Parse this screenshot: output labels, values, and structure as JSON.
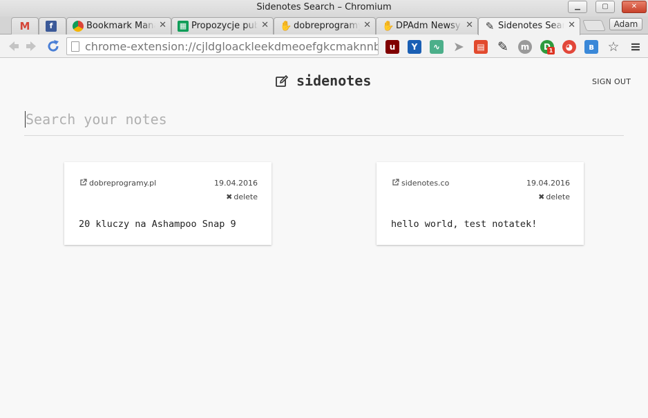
{
  "window": {
    "title": "Sidenotes Search – Chromium",
    "min_label": "▁",
    "max_label": "▢",
    "close_label": "✕"
  },
  "tabs": [
    {
      "label": "",
      "icon": "gmail-icon",
      "color": "#d44638"
    },
    {
      "label": "",
      "icon": "facebook-icon",
      "color": "#3b5998"
    },
    {
      "label": "Bookmark Mana",
      "icon": "bookmark-manager-icon",
      "color": "#e8a33b"
    },
    {
      "label": "Propozycje publ",
      "icon": "sheets-icon",
      "color": "#0f9d58"
    },
    {
      "label": "dobreprogramy",
      "icon": "dobreprogramy-icon",
      "color": "#e6b800"
    },
    {
      "label": "DPAdm Newsy",
      "icon": "dobreprogramy-icon",
      "color": "#e6b800"
    },
    {
      "label": "Sidenotes Searc",
      "icon": "edit-icon",
      "color": "#333333",
      "active": true
    }
  ],
  "tab_close": "✕",
  "profile_label": "Adam",
  "toolbar": {
    "url": "chrome-extension://cjldgloackleekdmeoefgkcmaknnbbpb/ht",
    "extensions": [
      {
        "name": "ublock-icon",
        "glyph": "u",
        "color": "#800000"
      },
      {
        "name": "y-extension-icon",
        "glyph": "Y",
        "color": "#1a5fb4"
      },
      {
        "name": "audio-wave-icon",
        "glyph": "∿",
        "color": "#4caf8a"
      },
      {
        "name": "cursor-icon",
        "glyph": "➤",
        "color": "#9a9a9a"
      },
      {
        "name": "color-stack-icon",
        "glyph": "▤",
        "color": "#e24a2e"
      },
      {
        "name": "sidenotes-edit-icon",
        "glyph": "✎",
        "color": "#333333"
      },
      {
        "name": "m-extension-icon",
        "glyph": "m",
        "color": "#9a9a9a"
      },
      {
        "name": "d-extension-icon",
        "glyph": "D",
        "color": "#2e9b3e"
      },
      {
        "name": "color-wheel-icon",
        "glyph": "◕",
        "color": "#e2473a"
      },
      {
        "name": "b-extension-icon",
        "glyph": "ʙ",
        "color": "#3a88d8"
      },
      {
        "name": "bookmark-star-icon",
        "glyph": "☆",
        "color": "#555555"
      },
      {
        "name": "menu-icon",
        "glyph": "≡",
        "color": "#444444"
      }
    ],
    "badge_count": "1"
  },
  "app": {
    "brand_name": "sidenotes",
    "sign_out": "SIGN OUT",
    "search_placeholder": "Search your notes",
    "search_value": ""
  },
  "notes": [
    {
      "source": "dobreprogramy.pl",
      "date": "19.04.2016",
      "delete_label": "delete",
      "text": "20 kluczy na Ashampoo Snap 9"
    },
    {
      "source": "sidenotes.co",
      "date": "19.04.2016",
      "delete_label": "delete",
      "text": "hello world, test notatek!"
    }
  ]
}
